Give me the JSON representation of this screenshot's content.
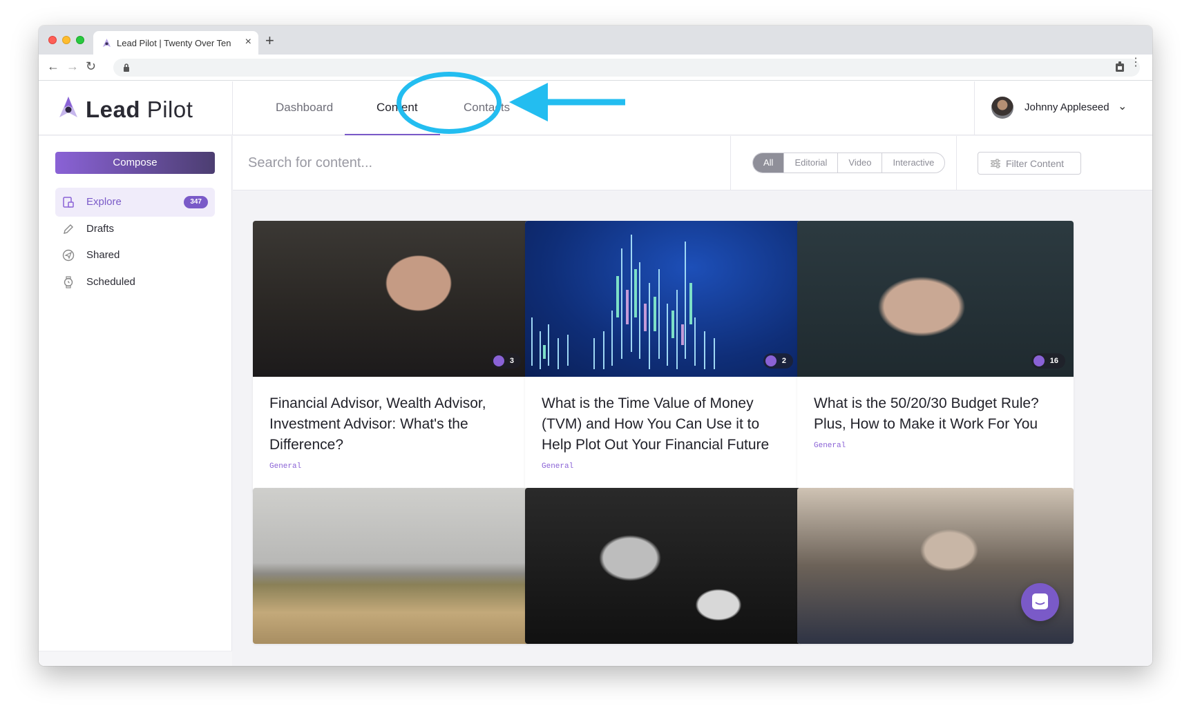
{
  "browser": {
    "tab_title": "Lead Pilot | Twenty Over Ten",
    "close_glyph": "×",
    "new_tab_glyph": "+",
    "back_glyph": "←",
    "forward_glyph": "→",
    "reload_glyph": "↻"
  },
  "app": {
    "logo": {
      "bold": "Lead",
      "regular": " Pilot"
    },
    "nav": [
      {
        "label": "Dashboard",
        "active": false
      },
      {
        "label": "Content",
        "active": true
      },
      {
        "label": "Contacts",
        "active": false
      }
    ],
    "user": {
      "name": "Johnny Appleseed",
      "caret": "⌄"
    },
    "accent_color": "#7a5ac8",
    "annotation_color": "#23bdf0"
  },
  "sidebar": {
    "compose_label": "Compose",
    "items": [
      {
        "label": "Explore",
        "icon": "explore-icon",
        "badge": "347",
        "active": true
      },
      {
        "label": "Drafts",
        "icon": "pencil-icon",
        "active": false
      },
      {
        "label": "Shared",
        "icon": "send-icon",
        "active": false
      },
      {
        "label": "Scheduled",
        "icon": "watch-icon",
        "active": false
      }
    ]
  },
  "search": {
    "placeholder": "Search for content..."
  },
  "filters": {
    "segments": [
      {
        "label": "All",
        "active": true
      },
      {
        "label": "Editorial",
        "active": false
      },
      {
        "label": "Video",
        "active": false
      },
      {
        "label": "Interactive",
        "active": false
      }
    ],
    "filter_button": "Filter Content"
  },
  "cards": [
    {
      "title": "Financial Advisor, Wealth Advisor, Investment Advisor: What's the Difference?",
      "tag": "General",
      "shares": "3",
      "image": "man-in-suit"
    },
    {
      "title": "What is the Time Value of Money (TVM) and How You Can Use it to Help Plot Out Your Financial Future",
      "tag": "General",
      "shares": "2",
      "image": "stock-chart"
    },
    {
      "title": "What is the 50/20/30 Budget Rule? Plus, How to Make it Work For You",
      "tag": "General",
      "shares": "16",
      "image": "counting-money"
    },
    {
      "image": "desert-man"
    },
    {
      "image": "elderly-women"
    },
    {
      "image": "man-on-steps"
    }
  ]
}
